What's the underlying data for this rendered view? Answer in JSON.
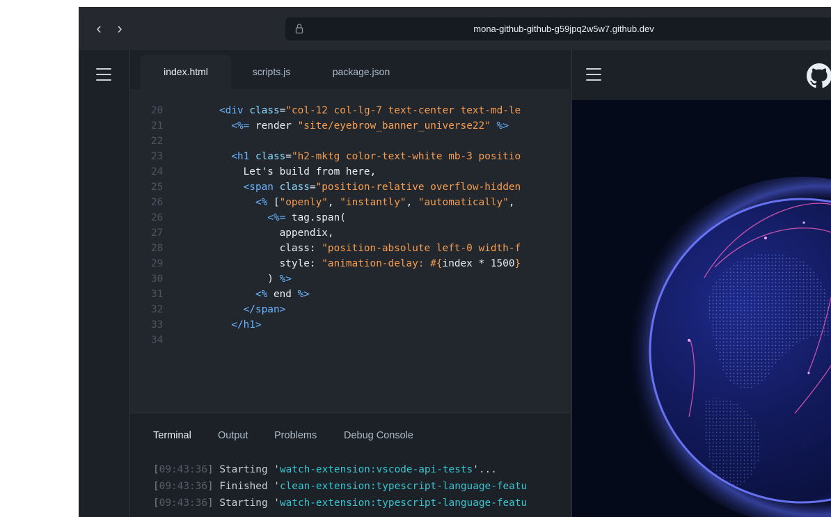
{
  "browser": {
    "back_icon": "chevron-left-icon",
    "forward_icon": "chevron-right-icon",
    "back_glyph": "‹",
    "forward_glyph": "›",
    "url": "mona-github-github-g59jpq2w5w7.github.dev",
    "lock_icon": "lock-icon"
  },
  "activity_bar": {
    "menu_icon": "hamburger-menu-icon"
  },
  "editor": {
    "tabs": [
      {
        "label": "index.html",
        "active": true
      },
      {
        "label": "scripts.js",
        "active": false
      },
      {
        "label": "package.json",
        "active": false
      }
    ],
    "lines": [
      {
        "n": "20",
        "tokens": [
          [
            "tag",
            "<div "
          ],
          [
            "attr",
            "class"
          ],
          [
            "text",
            "="
          ],
          [
            "str",
            "\"col-12 col-lg-7 text-center text-md-le"
          ]
        ],
        "indent": 0
      },
      {
        "n": "21",
        "tokens": [
          [
            "erb",
            "<%="
          ],
          [
            "text",
            " render "
          ],
          [
            "str",
            "\"site/eyebrow_banner_universe22\""
          ],
          [
            "text",
            " "
          ],
          [
            "erb",
            "%>"
          ]
        ],
        "indent": 2
      },
      {
        "n": "22",
        "tokens": [],
        "indent": 0
      },
      {
        "n": "23",
        "tokens": [
          [
            "tag",
            "<h1 "
          ],
          [
            "attr",
            "class"
          ],
          [
            "text",
            "="
          ],
          [
            "str",
            "\"h2-mktg color-text-white mb-3 positio"
          ]
        ],
        "indent": 2
      },
      {
        "n": "24",
        "tokens": [
          [
            "text",
            "Let's build from here,"
          ]
        ],
        "indent": 4
      },
      {
        "n": "25",
        "tokens": [
          [
            "tag",
            "<span "
          ],
          [
            "attr",
            "class"
          ],
          [
            "text",
            "="
          ],
          [
            "str",
            "\"position-relative overflow-hidden"
          ]
        ],
        "indent": 4
      },
      {
        "n": "26",
        "tokens": [
          [
            "erb",
            "<%"
          ],
          [
            "text",
            " ["
          ],
          [
            "str",
            "\"openly\""
          ],
          [
            "text",
            ", "
          ],
          [
            "str",
            "\"instantly\""
          ],
          [
            "text",
            ", "
          ],
          [
            "str",
            "\"automatically\""
          ],
          [
            "text",
            ","
          ]
        ],
        "indent": 6
      },
      {
        "n": "26",
        "tokens": [
          [
            "erb",
            "<%="
          ],
          [
            "text",
            " tag.span("
          ]
        ],
        "indent": 8
      },
      {
        "n": "27",
        "tokens": [
          [
            "text",
            "appendix,"
          ]
        ],
        "indent": 10
      },
      {
        "n": "28",
        "tokens": [
          [
            "text",
            "class: "
          ],
          [
            "str",
            "\"position-absolute left-0 width-f"
          ]
        ],
        "indent": 10
      },
      {
        "n": "29",
        "tokens": [
          [
            "text",
            "style: "
          ],
          [
            "str",
            "\"animation-delay: #{"
          ],
          [
            "text",
            "index * 1500"
          ],
          [
            "str",
            "}"
          ]
        ],
        "indent": 10
      },
      {
        "n": "30",
        "tokens": [
          [
            "text",
            ") "
          ],
          [
            "erb",
            "%>"
          ]
        ],
        "indent": 8
      },
      {
        "n": "31",
        "tokens": [
          [
            "erb",
            "<%"
          ],
          [
            "text",
            " end "
          ],
          [
            "erb",
            "%>"
          ]
        ],
        "indent": 6
      },
      {
        "n": "32",
        "tokens": [
          [
            "tag",
            "</span>"
          ]
        ],
        "indent": 4
      },
      {
        "n": "33",
        "tokens": [
          [
            "tag",
            "</h1>"
          ]
        ],
        "indent": 2
      },
      {
        "n": "34",
        "tokens": [],
        "indent": 0
      }
    ]
  },
  "panel": {
    "tabs": [
      {
        "label": "Terminal",
        "active": true
      },
      {
        "label": "Output",
        "active": false
      },
      {
        "label": "Problems",
        "active": false
      },
      {
        "label": "Debug Console",
        "active": false
      }
    ],
    "log": [
      {
        "time": "09:43:36",
        "verb": "Starting",
        "task": "watch-extension:vscode-api-tests",
        "suffix": "'..."
      },
      {
        "time": "09:43:36",
        "verb": "Finished",
        "task": "clean-extension:typescript-language-featu",
        "suffix": ""
      },
      {
        "time": "09:43:36",
        "verb": "Starting",
        "task": "watch-extension:typescript-language-featu",
        "suffix": ""
      }
    ]
  },
  "preview": {
    "menu_icon": "hamburger-menu-icon",
    "logo_icon": "github-logo-icon"
  },
  "colors": {
    "background": "#1c2128",
    "editor_bg": "#22272e",
    "tag": "#6cb6ff",
    "string": "#f69d50",
    "task": "#39c5cf"
  }
}
